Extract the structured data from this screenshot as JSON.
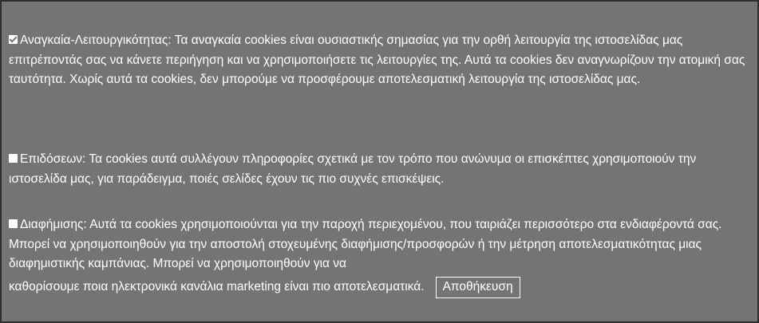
{
  "cookie_settings": {
    "necessary": {
      "checked": true,
      "label": "Αναγκαία-Λειτουργικότητας:",
      "description": " Τα αναγκαία cookies είναι ουσιαστικής σημασίας για την ορθή λειτουργία της ιστοσελίδας μας επιτρέποντάς σας να κάνετε περιήγηση και να χρησιμοποιήσετε τις λειτουργίες της. Αυτά τα cookies δεν αναγνωρίζουν την ατομική σας ταυτότητα. Χωρίς αυτά τα cookies, δεν μπορούμε να προσφέρουμε αποτελεσματική λειτουργία της ιστοσελίδας μας."
    },
    "performance": {
      "checked": false,
      "label": "Επιδόσεων:",
      "description": " Τα cookies αυτά συλλέγουν πληροφορίες σχετικά με τον τρόπο που ανώνυμα οι επισκέπτες χρησιμοποιούν την ιστοσελίδα μας, για παράδειγμα, ποιές σελίδες έχουν τις πιο συχνές επισκέψεις."
    },
    "advertising": {
      "checked": false,
      "label": "Διαφήμισης:",
      "description": " Αυτά τα cookies χρησιμοποιούνται για την παροχή περιεχομένου, που ταιριάζει περισσότερο στα ενδιαφέροντά σας. Μπορεί να χρησιμοποιηθούν για την αποστολή στοχευμένης διαφήμισης/προσφορών ή την μέτρηση αποτελεσματικότητας μιας διαφημιστικής καμπάνιας. Μπορεί να χρησιμοποιηθούν για να",
      "description_last": "καθορίσουμε ποια ηλεκτρονικά κανάλια marketing είναι πιο αποτελεσματικά."
    },
    "save_label": "Αποθήκευση",
    "colors": {
      "panel_background": "#747474",
      "panel_border": "#2e2e2e",
      "text": "#ffffff"
    }
  }
}
